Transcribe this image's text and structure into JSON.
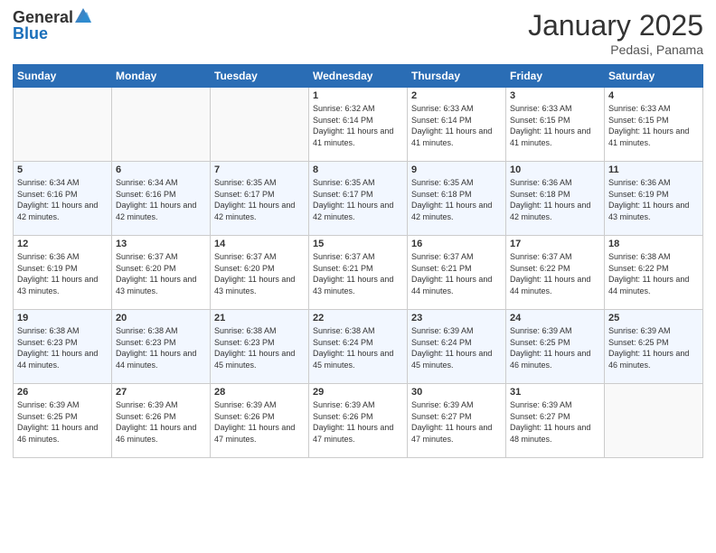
{
  "header": {
    "logo_general": "General",
    "logo_blue": "Blue",
    "month": "January 2025",
    "location": "Pedasi, Panama"
  },
  "days_of_week": [
    "Sunday",
    "Monday",
    "Tuesday",
    "Wednesday",
    "Thursday",
    "Friday",
    "Saturday"
  ],
  "weeks": [
    [
      {
        "num": "",
        "info": ""
      },
      {
        "num": "",
        "info": ""
      },
      {
        "num": "",
        "info": ""
      },
      {
        "num": "1",
        "info": "Sunrise: 6:32 AM\nSunset: 6:14 PM\nDaylight: 11 hours and 41 minutes."
      },
      {
        "num": "2",
        "info": "Sunrise: 6:33 AM\nSunset: 6:14 PM\nDaylight: 11 hours and 41 minutes."
      },
      {
        "num": "3",
        "info": "Sunrise: 6:33 AM\nSunset: 6:15 PM\nDaylight: 11 hours and 41 minutes."
      },
      {
        "num": "4",
        "info": "Sunrise: 6:33 AM\nSunset: 6:15 PM\nDaylight: 11 hours and 41 minutes."
      }
    ],
    [
      {
        "num": "5",
        "info": "Sunrise: 6:34 AM\nSunset: 6:16 PM\nDaylight: 11 hours and 42 minutes."
      },
      {
        "num": "6",
        "info": "Sunrise: 6:34 AM\nSunset: 6:16 PM\nDaylight: 11 hours and 42 minutes."
      },
      {
        "num": "7",
        "info": "Sunrise: 6:35 AM\nSunset: 6:17 PM\nDaylight: 11 hours and 42 minutes."
      },
      {
        "num": "8",
        "info": "Sunrise: 6:35 AM\nSunset: 6:17 PM\nDaylight: 11 hours and 42 minutes."
      },
      {
        "num": "9",
        "info": "Sunrise: 6:35 AM\nSunset: 6:18 PM\nDaylight: 11 hours and 42 minutes."
      },
      {
        "num": "10",
        "info": "Sunrise: 6:36 AM\nSunset: 6:18 PM\nDaylight: 11 hours and 42 minutes."
      },
      {
        "num": "11",
        "info": "Sunrise: 6:36 AM\nSunset: 6:19 PM\nDaylight: 11 hours and 43 minutes."
      }
    ],
    [
      {
        "num": "12",
        "info": "Sunrise: 6:36 AM\nSunset: 6:19 PM\nDaylight: 11 hours and 43 minutes."
      },
      {
        "num": "13",
        "info": "Sunrise: 6:37 AM\nSunset: 6:20 PM\nDaylight: 11 hours and 43 minutes."
      },
      {
        "num": "14",
        "info": "Sunrise: 6:37 AM\nSunset: 6:20 PM\nDaylight: 11 hours and 43 minutes."
      },
      {
        "num": "15",
        "info": "Sunrise: 6:37 AM\nSunset: 6:21 PM\nDaylight: 11 hours and 43 minutes."
      },
      {
        "num": "16",
        "info": "Sunrise: 6:37 AM\nSunset: 6:21 PM\nDaylight: 11 hours and 44 minutes."
      },
      {
        "num": "17",
        "info": "Sunrise: 6:37 AM\nSunset: 6:22 PM\nDaylight: 11 hours and 44 minutes."
      },
      {
        "num": "18",
        "info": "Sunrise: 6:38 AM\nSunset: 6:22 PM\nDaylight: 11 hours and 44 minutes."
      }
    ],
    [
      {
        "num": "19",
        "info": "Sunrise: 6:38 AM\nSunset: 6:23 PM\nDaylight: 11 hours and 44 minutes."
      },
      {
        "num": "20",
        "info": "Sunrise: 6:38 AM\nSunset: 6:23 PM\nDaylight: 11 hours and 44 minutes."
      },
      {
        "num": "21",
        "info": "Sunrise: 6:38 AM\nSunset: 6:23 PM\nDaylight: 11 hours and 45 minutes."
      },
      {
        "num": "22",
        "info": "Sunrise: 6:38 AM\nSunset: 6:24 PM\nDaylight: 11 hours and 45 minutes."
      },
      {
        "num": "23",
        "info": "Sunrise: 6:39 AM\nSunset: 6:24 PM\nDaylight: 11 hours and 45 minutes."
      },
      {
        "num": "24",
        "info": "Sunrise: 6:39 AM\nSunset: 6:25 PM\nDaylight: 11 hours and 46 minutes."
      },
      {
        "num": "25",
        "info": "Sunrise: 6:39 AM\nSunset: 6:25 PM\nDaylight: 11 hours and 46 minutes."
      }
    ],
    [
      {
        "num": "26",
        "info": "Sunrise: 6:39 AM\nSunset: 6:25 PM\nDaylight: 11 hours and 46 minutes."
      },
      {
        "num": "27",
        "info": "Sunrise: 6:39 AM\nSunset: 6:26 PM\nDaylight: 11 hours and 46 minutes."
      },
      {
        "num": "28",
        "info": "Sunrise: 6:39 AM\nSunset: 6:26 PM\nDaylight: 11 hours and 47 minutes."
      },
      {
        "num": "29",
        "info": "Sunrise: 6:39 AM\nSunset: 6:26 PM\nDaylight: 11 hours and 47 minutes."
      },
      {
        "num": "30",
        "info": "Sunrise: 6:39 AM\nSunset: 6:27 PM\nDaylight: 11 hours and 47 minutes."
      },
      {
        "num": "31",
        "info": "Sunrise: 6:39 AM\nSunset: 6:27 PM\nDaylight: 11 hours and 48 minutes."
      },
      {
        "num": "",
        "info": ""
      }
    ]
  ]
}
